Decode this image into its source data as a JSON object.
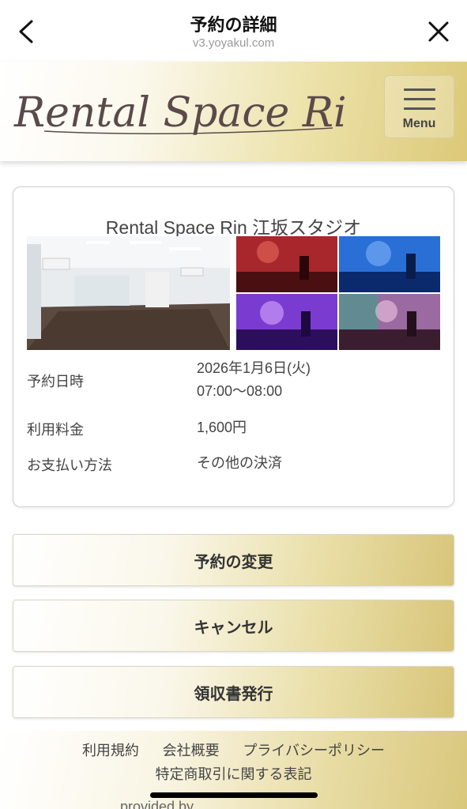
{
  "browser": {
    "title": "予約の詳細",
    "url": "v3.yoyakul.com"
  },
  "header": {
    "logo_text": "Rental Space Rin.",
    "menu_label": "Menu"
  },
  "reservation": {
    "studio_name": "Rental Space Rin 江坂スタジオ",
    "date_label": "予約日時",
    "date_value": "2026年1月6日(火)",
    "time_value": "07:00〜08:00",
    "fee_label": "利用料金",
    "fee_value": "1,600円",
    "payment_label": "お支払い方法",
    "payment_value": "その他の決済"
  },
  "actions": {
    "change_label": "予約の変更",
    "cancel_label": "キャンセル",
    "receipt_label": "領収書発行"
  },
  "footer": {
    "terms": "利用規約",
    "company": "会社概要",
    "privacy": "プライバシーポリシー",
    "commerce": "特定商取引に関する表記",
    "provided_by": "provided by"
  },
  "colors": {
    "gold_accent": "#dcc978",
    "text": "#444444"
  }
}
